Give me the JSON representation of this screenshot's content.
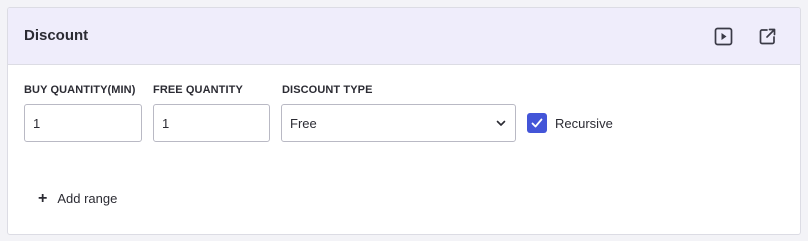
{
  "panel": {
    "title": "Discount",
    "icons": [
      "play-icon",
      "external-link-icon"
    ]
  },
  "fields": {
    "buy_quantity": {
      "label": "BUY QUANTITY(MIN)",
      "value": "1"
    },
    "free_quantity": {
      "label": "FREE QUANTITY",
      "value": "1"
    },
    "discount_type": {
      "label": "DISCOUNT TYPE",
      "value": "Free"
    },
    "recursive": {
      "label": "Recursive",
      "checked": true
    }
  },
  "actions": {
    "add_range_label": "Add range"
  },
  "colors": {
    "header_bg": "#efedfb",
    "accent": "#4355d8"
  }
}
